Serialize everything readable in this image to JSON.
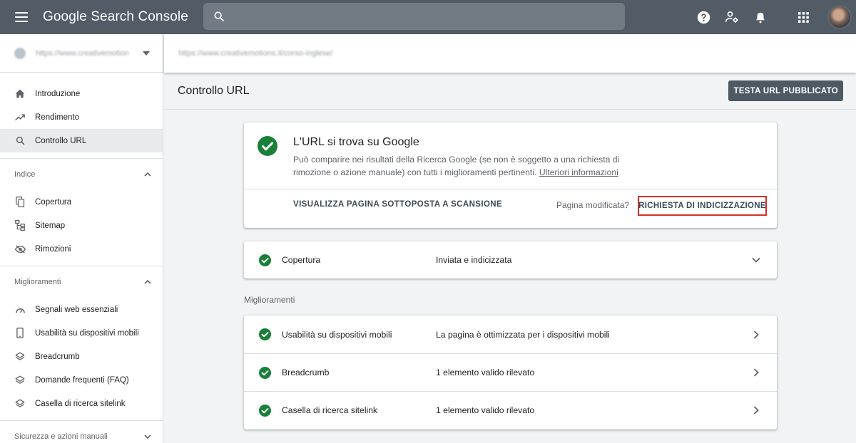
{
  "topbar": {
    "app_name_google": "Google",
    "app_name_product": "Search Console",
    "search_placeholder": ""
  },
  "sidebar": {
    "property_url": "https://www.creativemotions.it/",
    "main_items": [
      {
        "label": "Introduzione",
        "icon": "home-icon"
      },
      {
        "label": "Rendimento",
        "icon": "trending-up-icon"
      },
      {
        "label": "Controllo URL",
        "icon": "search-icon",
        "active": true
      }
    ],
    "index_section": {
      "title": "Indice",
      "items": [
        {
          "label": "Copertura",
          "icon": "copy-icon"
        },
        {
          "label": "Sitemap",
          "icon": "sitemap-icon"
        },
        {
          "label": "Rimozioni",
          "icon": "eye-off-icon"
        }
      ]
    },
    "enhancements_section": {
      "title": "Miglioramenti",
      "items": [
        {
          "label": "Segnali web essenziali",
          "icon": "speedometer-icon"
        },
        {
          "label": "Usabilità su dispositivi mobili",
          "icon": "phone-icon"
        },
        {
          "label": "Breadcrumb",
          "icon": "layers-icon"
        },
        {
          "label": "Domande frequenti (FAQ)",
          "icon": "layers-icon"
        },
        {
          "label": "Casella di ricerca sitelink",
          "icon": "layers-icon"
        }
      ]
    },
    "security_section": {
      "title": "Sicurezza e azioni manuali"
    }
  },
  "url_bar": {
    "inspected_url": "https://www.creativemotions.it/corso-inglese/"
  },
  "page": {
    "title": "Controllo URL",
    "test_live_button": "TESTA URL PUBBLICATO"
  },
  "status": {
    "title": "L'URL si trova su Google",
    "description": "Può comparire nei risultati della Ricerca Google (se non è soggetto a una richiesta di rimozione o azione manuale) con tutti i miglioramenti pertinenti. ",
    "learn_more": "Ulteriori informazioni",
    "view_crawled_button": "VISUALIZZA PAGINA SOTTOPOSTA A SCANSIONE",
    "page_modified": "Pagina modificata?",
    "request_indexing_button": "RICHIESTA DI INDICIZZAZIONE"
  },
  "coverage": {
    "label": "Copertura",
    "value": "Inviata e indicizzata"
  },
  "enhancements": {
    "heading": "Miglioramenti",
    "rows": [
      {
        "label": "Usabilità su dispositivi mobili",
        "value": "La pagina è ottimizzata per i dispositivi mobili"
      },
      {
        "label": "Breadcrumb",
        "value": "1 elemento valido rilevato"
      },
      {
        "label": "Casella di ricerca sitelink",
        "value": "1 elemento valido rilevato"
      }
    ]
  },
  "colors": {
    "topbar": "#525c66",
    "success_green": "#188038",
    "highlight_red": "#d93025",
    "button_dark": "#4d5963"
  }
}
